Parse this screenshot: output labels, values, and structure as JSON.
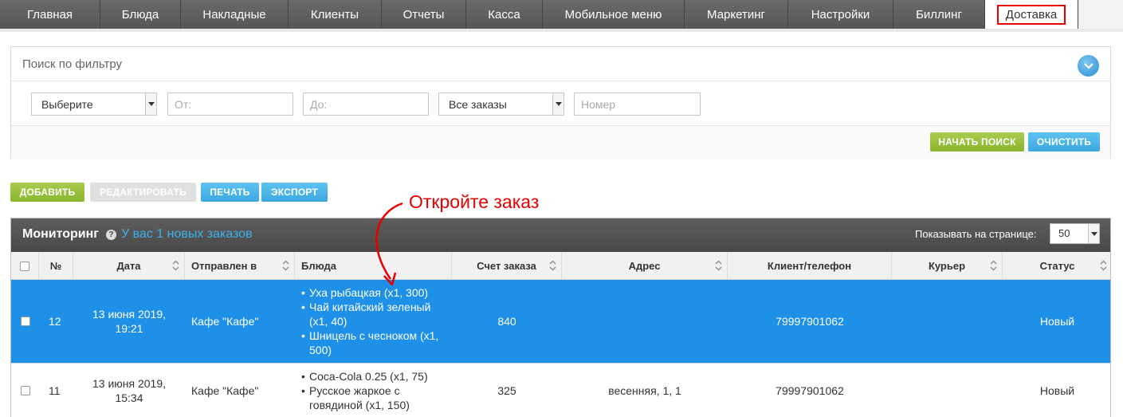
{
  "nav": {
    "tabs": [
      {
        "label": "Главная"
      },
      {
        "label": "Блюда"
      },
      {
        "label": "Накладные"
      },
      {
        "label": "Клиенты"
      },
      {
        "label": "Отчеты"
      },
      {
        "label": "Касса"
      },
      {
        "label": "Мобильное меню"
      },
      {
        "label": "Маркетинг"
      },
      {
        "label": "Настройки"
      },
      {
        "label": "Биллинг"
      },
      {
        "label": "Доставка"
      }
    ],
    "active": "Доставка",
    "highlight_color": "#e60000"
  },
  "filter": {
    "title": "Поиск по фильтру",
    "select_type": "Выберите",
    "from_placeholder": "От:",
    "to_placeholder": "До:",
    "select_orders": "Все заказы",
    "number_placeholder": "Номер",
    "search_label": "НАЧАТЬ ПОИСК",
    "clear_label": "ОЧИСТИТЬ"
  },
  "toolbar": {
    "add_label": "ДОБАВИТЬ",
    "edit_label": "РЕДАКТИРОВАТЬ",
    "print_label": "ПЕЧАТЬ",
    "export_label": "ЭКСПОРТ"
  },
  "annotation": {
    "text": "Откройте заказ",
    "color": "#e60000"
  },
  "monitoring": {
    "title": "Мониторинг",
    "new_orders": "У вас 1 новых заказов",
    "per_page_label": "Показывать на странице:",
    "per_page_value": "50",
    "columns": {
      "num": "№",
      "date": "Дата",
      "sent_to": "Отправлен в",
      "dishes": "Блюда",
      "total": "Счет заказа",
      "address": "Адрес",
      "client": "Клиент/телефон",
      "courier": "Курьер",
      "status": "Статус"
    },
    "rows": [
      {
        "num": "12",
        "date": "13 июня 2019, 19:21",
        "sent_to": "Кафе \"Кафе\"",
        "dishes": [
          "Уха рыбацкая (x1, 300)",
          "Чай китайский зеленый (x1, 40)",
          "Шницель с чесноком (x1, 500)"
        ],
        "total": "840",
        "address": "",
        "client": "79997901062",
        "courier": "",
        "status": "Новый",
        "selected": true
      },
      {
        "num": "11",
        "date": "13 июня 2019, 15:34",
        "sent_to": "Кафе \"Кафе\"",
        "dishes": [
          "Coca-Cola 0.25 (x1, 75)",
          "Русское жаркое с говядиной (x1, 150)"
        ],
        "total": "325",
        "address": "весенняя, 1, 1",
        "client": "79997901062",
        "courier": "",
        "status": "Новый",
        "selected": false
      }
    ],
    "selected_row_color": "#1e90e8"
  }
}
